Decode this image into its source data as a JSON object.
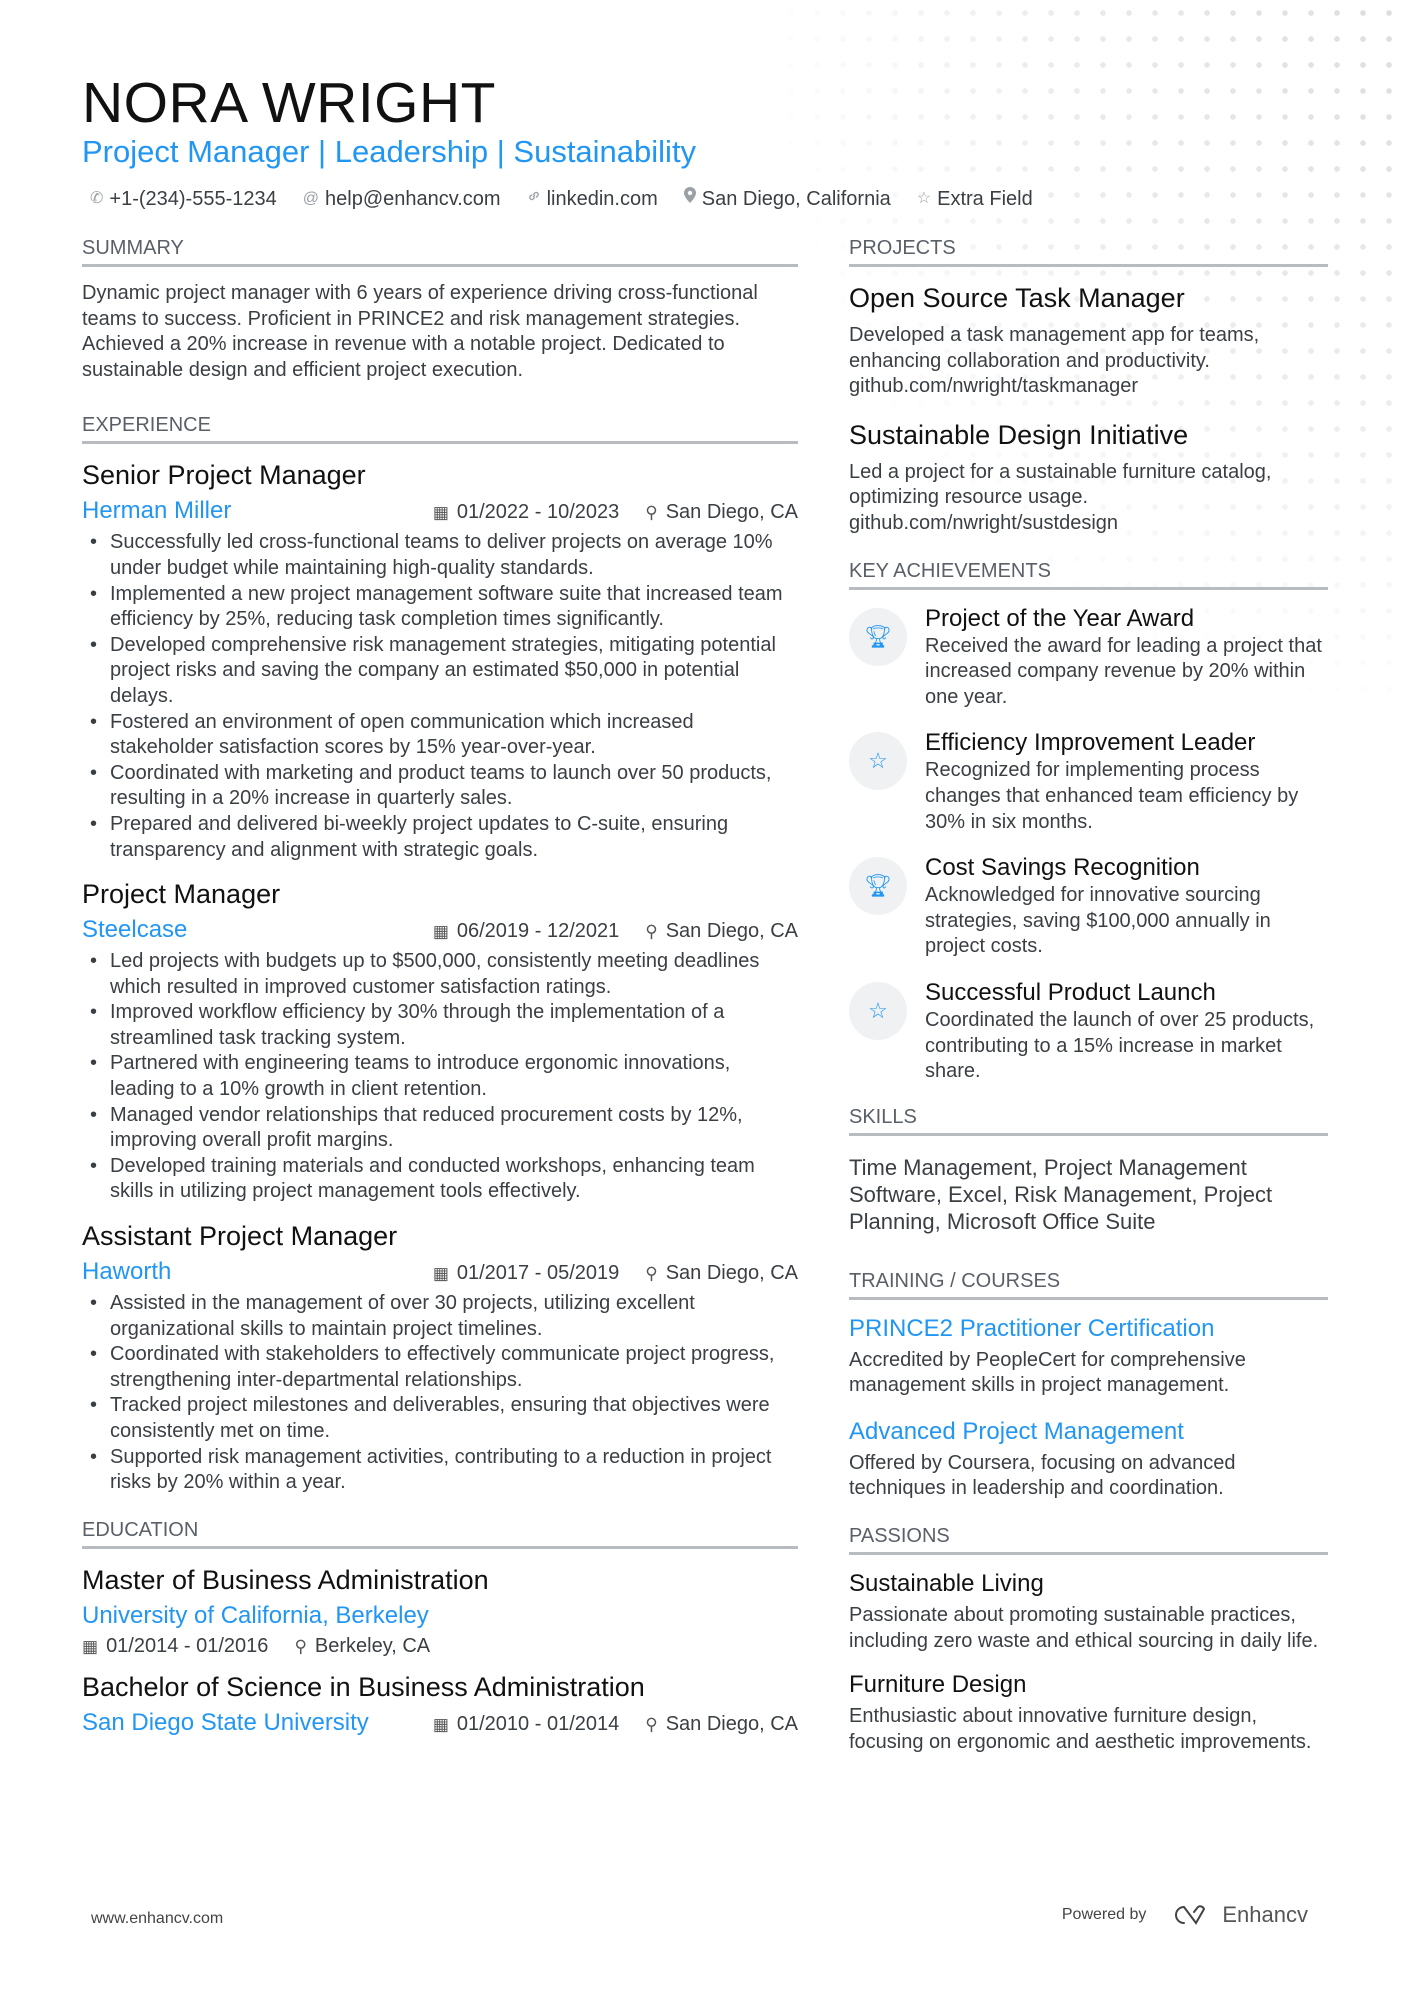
{
  "header": {
    "name": "NORA WRIGHT",
    "title": "Project Manager | Leadership | Sustainability",
    "contacts": [
      {
        "icon": "phone-icon",
        "glyph": "✆",
        "text": "+1-(234)-555-1234"
      },
      {
        "icon": "at-icon",
        "glyph": "@",
        "text": "help@enhancv.com"
      },
      {
        "icon": "link-icon",
        "glyph": "🔗︎",
        "text": "linkedin.com"
      },
      {
        "icon": "location-icon",
        "glyph": "⚲",
        "text": "San Diego, California"
      },
      {
        "icon": "star-icon",
        "glyph": "☆",
        "text": "Extra Field"
      }
    ]
  },
  "summary": {
    "heading": "Summary",
    "text": "Dynamic project manager with 6 years of experience driving cross-functional teams to success. Proficient in PRINCE2 and risk management strategies. Achieved a 20% increase in revenue with a notable project. Dedicated to sustainable design and efficient project execution."
  },
  "experience": {
    "heading": "Experience",
    "jobs": [
      {
        "title": "Senior Project Manager",
        "company": "Herman Miller",
        "dates": "01/2022 - 10/2023",
        "location": "San Diego, CA",
        "bullets": [
          "Successfully led cross-functional teams to deliver projects on average 10% under budget while maintaining high-quality standards.",
          "Implemented a new project management software suite that increased team efficiency by 25%, reducing task completion times significantly.",
          "Developed comprehensive risk management strategies, mitigating potential project risks and saving the company an estimated $50,000 in potential delays.",
          "Fostered an environment of open communication which increased stakeholder satisfaction scores by 15% year-over-year.",
          "Coordinated with marketing and product teams to launch over 50 products, resulting in a 20% increase in quarterly sales.",
          "Prepared and delivered bi-weekly project updates to C-suite, ensuring transparency and alignment with strategic goals."
        ]
      },
      {
        "title": "Project Manager",
        "company": "Steelcase",
        "dates": "06/2019 - 12/2021",
        "location": "San Diego, CA",
        "bullets": [
          "Led projects with budgets up to $500,000, consistently meeting deadlines which resulted in improved customer satisfaction ratings.",
          "Improved workflow efficiency by 30% through the implementation of a streamlined task tracking system.",
          "Partnered with engineering teams to introduce ergonomic innovations, leading to a 10% growth in client retention.",
          "Managed vendor relationships that reduced procurement costs by 12%, improving overall profit margins.",
          "Developed training materials and conducted workshops, enhancing team skills in utilizing project management tools effectively."
        ]
      },
      {
        "title": "Assistant Project Manager",
        "company": "Haworth",
        "dates": "01/2017 - 05/2019",
        "location": "San Diego, CA",
        "bullets": [
          "Assisted in the management of over 30 projects, utilizing excellent organizational skills to maintain project timelines.",
          "Coordinated with stakeholders to effectively communicate project progress, strengthening inter-departmental relationships.",
          "Tracked project milestones and deliverables, ensuring that objectives were consistently met on time.",
          "Supported risk management activities, contributing to a reduction in project risks by 20% within a year."
        ]
      }
    ]
  },
  "education": {
    "heading": "Education",
    "items": [
      {
        "degree": "Master of Business Administration",
        "school": "University of California, Berkeley",
        "dates": "01/2014 - 01/2016",
        "location": "Berkeley, CA"
      },
      {
        "degree": "Bachelor of Science in Business Administration",
        "school": "San Diego State University",
        "dates": "01/2010 - 01/2014",
        "location": "San Diego, CA"
      }
    ]
  },
  "projects": {
    "heading": "Projects",
    "items": [
      {
        "title": "Open Source Task Manager",
        "description": "Developed a task management app for teams, enhancing collaboration and productivity.",
        "link": "github.com/nwright/taskmanager"
      },
      {
        "title": "Sustainable Design Initiative",
        "description": "Led a project for a sustainable furniture catalog, optimizing resource usage.",
        "link": "github.com/nwright/sustdesign"
      }
    ]
  },
  "achievements": {
    "heading": "Key Achievements",
    "items": [
      {
        "icon": "trophy-icon",
        "glyph": "🏆︎",
        "title": "Project of the Year Award",
        "description": "Received the award for leading a project that increased company revenue by 20% within one year."
      },
      {
        "icon": "star-icon",
        "glyph": "☆",
        "title": "Efficiency Improvement Leader",
        "description": "Recognized for implementing process changes that enhanced team efficiency by 30% in six months."
      },
      {
        "icon": "trophy-icon",
        "glyph": "🏆︎",
        "title": "Cost Savings Recognition",
        "description": "Acknowledged for innovative sourcing strategies, saving $100,000 annually in project costs."
      },
      {
        "icon": "star-icon",
        "glyph": "☆",
        "title": "Successful Product Launch",
        "description": "Coordinated the launch of over 25 products, contributing to a 15% increase in market share."
      }
    ]
  },
  "skills": {
    "heading": "Skills",
    "text": "Time Management, Project Management Software, Excel, Risk Management, Project Planning, Microsoft Office Suite"
  },
  "training": {
    "heading": "Training / Courses",
    "items": [
      {
        "title": "PRINCE2 Practitioner Certification",
        "description": "Accredited by PeopleCert for comprehensive management skills in project management."
      },
      {
        "title": "Advanced Project Management",
        "description": "Offered by Coursera, focusing on advanced techniques in leadership and coordination."
      }
    ]
  },
  "passions": {
    "heading": "Passions",
    "items": [
      {
        "title": "Sustainable Living",
        "description": "Passionate about promoting sustainable practices, including zero waste and ethical sourcing in daily life."
      },
      {
        "title": "Furniture Design",
        "description": "Enthusiastic about innovative furniture design, focusing on ergonomic and aesthetic improvements."
      }
    ]
  },
  "footer": {
    "website": "www.enhancv.com",
    "powered_by": "Powered by",
    "brand": "Enhancv"
  },
  "colors": {
    "accent": "#2196f3",
    "heading_rule": "#b8bcc0",
    "text": "#3a3f44"
  }
}
